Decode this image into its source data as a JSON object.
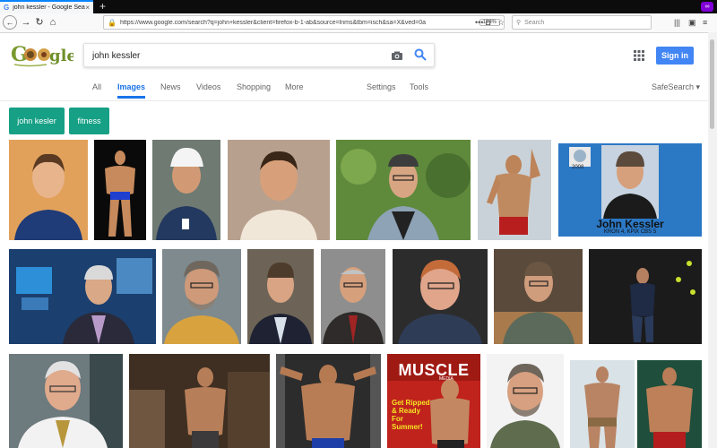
{
  "browser": {
    "tab_title": "john kessler - Google Search",
    "tab_close": "×",
    "new_tab": "+",
    "url": "https://www.google.com/search?q=john+kessler&client=firefox-b-1-ab&source=lnms&tbm=isch&sa=X&ved=0a",
    "zoom": "133%",
    "page_actions": "•••",
    "search_placeholder": "Search"
  },
  "google": {
    "query": "john kessler",
    "tabs": [
      "All",
      "Images",
      "News",
      "Videos",
      "Shopping",
      "More"
    ],
    "settings": "Settings",
    "tools": "Tools",
    "safesearch": "SafeSearch",
    "signin": "Sign in",
    "chips": [
      "john kesler",
      "fitness"
    ]
  },
  "overlays": {
    "card_year": "2008",
    "card_name": "John Kessler",
    "card_sub": "KRON 4, KPIX CBS 5",
    "magazine_title": "MUSCLE",
    "magazine_subtitle": "MEDIA",
    "magazine_headline": "Get Ripped & Ready For Summer!"
  },
  "colors": {
    "chip": "#16a085",
    "signin": "#4285f4",
    "active_tab": "#1a73e8",
    "card_bg": "#2b78c5",
    "magazine_bg": "#c0221c"
  }
}
